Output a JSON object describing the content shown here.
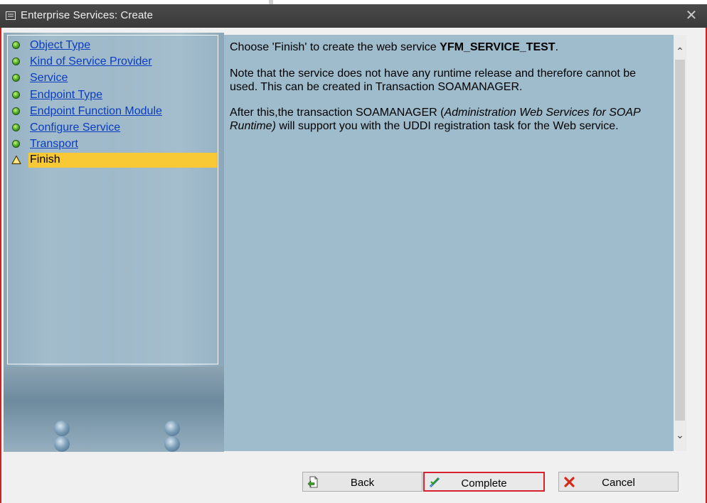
{
  "window": {
    "title": "Enterprise Services: Create",
    "close_glyph": "✕"
  },
  "steps": [
    {
      "label": "Object Type",
      "status": "done"
    },
    {
      "label": "Kind of Service Provider",
      "status": "done"
    },
    {
      "label": "Service",
      "status": "done"
    },
    {
      "label": "Endpoint Type",
      "status": "done"
    },
    {
      "label": "Endpoint Function Module",
      "status": "done"
    },
    {
      "label": "Configure Service",
      "status": "done"
    },
    {
      "label": "Transport",
      "status": "done"
    },
    {
      "label": "Finish",
      "status": "current"
    }
  ],
  "content": {
    "p1_prefix": "Choose 'Finish' to create the web service ",
    "p1_service": "YFM_SERVICE_TEST",
    "p1_suffix": ".",
    "p2": "Note that the service does not have any runtime release and therefore cannot be used. This can be created in Transaction SOAMANAGER.",
    "p3_prefix": "After this,the transaction SOAMANAGER (",
    "p3_italic": "Administration Web Services for SOAP Runtime)",
    "p3_suffix": " will support you with the UDDI registration task for the Web service."
  },
  "scrollbar": {
    "up_glyph": "⌃",
    "down_glyph": "⌄"
  },
  "buttons": {
    "back": "Back",
    "complete": "Complete",
    "cancel": "Cancel"
  },
  "colors": {
    "current_step_highlight": "#f8c934",
    "link": "#0a3cbf",
    "content_bg": "#9fbccd",
    "highlight_border": "#d8202e"
  }
}
